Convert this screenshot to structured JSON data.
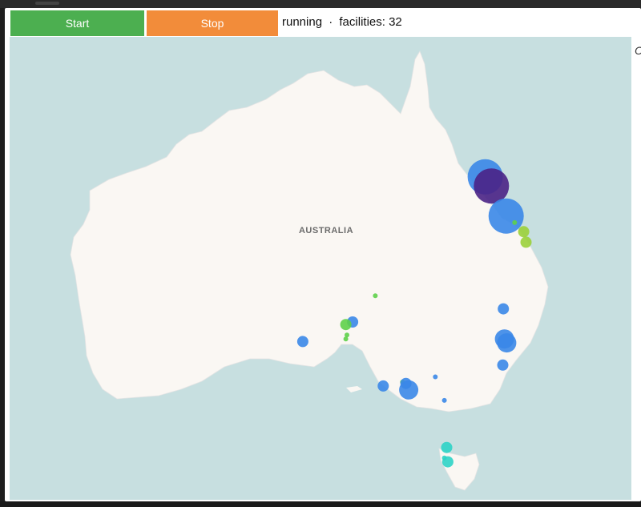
{
  "controls": {
    "start_label": "Start",
    "stop_label": "Stop",
    "status_state": "running",
    "status_separator": "·",
    "status_count_label": "facilities:",
    "status_count": "32"
  },
  "map": {
    "country_label": "AUSTRALIA",
    "edge_text": "C",
    "land_color": "#faf7f3",
    "water_color": "#c7dfe0",
    "label_color": "#6b6b6b"
  },
  "markers": [
    {
      "lat": -20.4,
      "lon": 148.6,
      "size": 3,
      "color": "#3a87e8",
      "opacity": 0.9
    },
    {
      "lat": -21.1,
      "lon": 149.15,
      "size": 3,
      "color": "#4a2286",
      "opacity": 0.9
    },
    {
      "lat": -23.4,
      "lon": 150.45,
      "size": 3,
      "color": "#3a87e8",
      "opacity": 0.9
    },
    {
      "lat": -24.6,
      "lon": 152.0,
      "size": 1,
      "color": "#9bd03a",
      "opacity": 0.9
    },
    {
      "lat": -25.4,
      "lon": 152.2,
      "size": 1,
      "color": "#9bd03a",
      "opacity": 0.9
    },
    {
      "lat": -23.9,
      "lon": 151.2,
      "size": 0,
      "color": "#5ed04a",
      "opacity": 0.9
    },
    {
      "lat": -30.5,
      "lon": 150.2,
      "size": 1,
      "color": "#3a87e8",
      "opacity": 0.9
    },
    {
      "lat": -32.8,
      "lon": 150.3,
      "size": 2,
      "color": "#3a87e8",
      "opacity": 0.9
    },
    {
      "lat": -33.1,
      "lon": 150.5,
      "size": 2,
      "color": "#3a87e8",
      "opacity": 0.9
    },
    {
      "lat": -34.8,
      "lon": 150.15,
      "size": 1,
      "color": "#3a87e8",
      "opacity": 0.9
    },
    {
      "lat": -29.5,
      "lon": 138.9,
      "size": 0,
      "color": "#5ed04a",
      "opacity": 0.9
    },
    {
      "lat": -31.5,
      "lon": 136.9,
      "size": 1,
      "color": "#3a87e8",
      "opacity": 0.9
    },
    {
      "lat": -31.7,
      "lon": 136.3,
      "size": 1,
      "color": "#5ed04a",
      "opacity": 0.9
    },
    {
      "lat": -32.5,
      "lon": 136.4,
      "size": 0,
      "color": "#5ed04a",
      "opacity": 0.9
    },
    {
      "lat": -32.8,
      "lon": 136.3,
      "size": 0,
      "color": "#5ed04a",
      "opacity": 0.9
    },
    {
      "lat": -33.0,
      "lon": 132.5,
      "size": 1,
      "color": "#3a87e8",
      "opacity": 0.9
    },
    {
      "lat": -36.4,
      "lon": 139.6,
      "size": 1,
      "color": "#3a87e8",
      "opacity": 0.9
    },
    {
      "lat": -36.1,
      "lon": 141.3,
      "size": 0,
      "color": "#5ed04a",
      "opacity": 0.9
    },
    {
      "lat": -36.2,
      "lon": 141.6,
      "size": 1,
      "color": "#3a87e8",
      "opacity": 0.9
    },
    {
      "lat": -36.7,
      "lon": 141.85,
      "size": 2,
      "color": "#3a87e8",
      "opacity": 0.9
    },
    {
      "lat": -35.7,
      "lon": 144.2,
      "size": 0,
      "color": "#3a87e8",
      "opacity": 0.9
    },
    {
      "lat": -37.5,
      "lon": 145.0,
      "size": 0,
      "color": "#3a87e8",
      "opacity": 0.9
    },
    {
      "lat": -41.1,
      "lon": 145.2,
      "size": 1,
      "color": "#2ed3c6",
      "opacity": 0.9
    },
    {
      "lat": -41.9,
      "lon": 145.0,
      "size": 0,
      "color": "#2ed3c6",
      "opacity": 0.9
    },
    {
      "lat": -42.2,
      "lon": 145.3,
      "size": 1,
      "color": "#2ed3c6",
      "opacity": 0.9
    }
  ]
}
